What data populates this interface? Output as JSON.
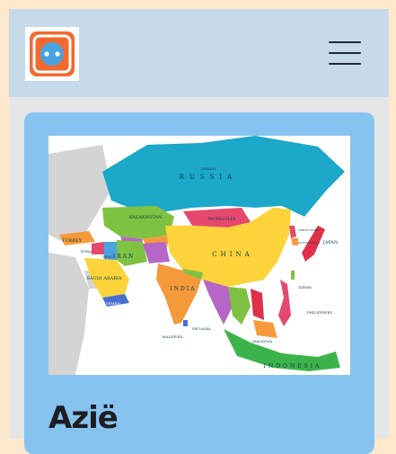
{
  "header": {
    "logo_icon": "power-socket-icon",
    "menu_icon": "hamburger-menu-icon"
  },
  "card": {
    "title": "Azië",
    "map": {
      "labels": {
        "russia_small": "(ASIAN)",
        "russia": "RUSSIA",
        "kazakhstan": "KAZAKHSTAN",
        "mongolia": "MONGOLIA",
        "china": "CHINA",
        "japan": "JAPAN",
        "turkey": "TURKEY",
        "iran": "IRAN",
        "iraq": "IRAQ",
        "syria": "SYRIA",
        "saudi_arabia": "SAUDI ARABIA",
        "yemen": "YEMEN",
        "india": "INDIA",
        "philippines": "PHILIPPINES",
        "maldives": "MALDIVES",
        "sri_lanka": "SRI LANKA",
        "malaysia": "MALAYSIA",
        "indonesia": "INDONESIA",
        "taiwan": "TAIWAN",
        "north_korea": "NORTH KOREA",
        "south_korea": "SOUTH KOREA"
      }
    }
  },
  "colors": {
    "page_bg": "#fde8cb",
    "header_bg": "#c7daea",
    "card_bg": "#86c3ee",
    "logo_orange": "#f26a2e"
  }
}
